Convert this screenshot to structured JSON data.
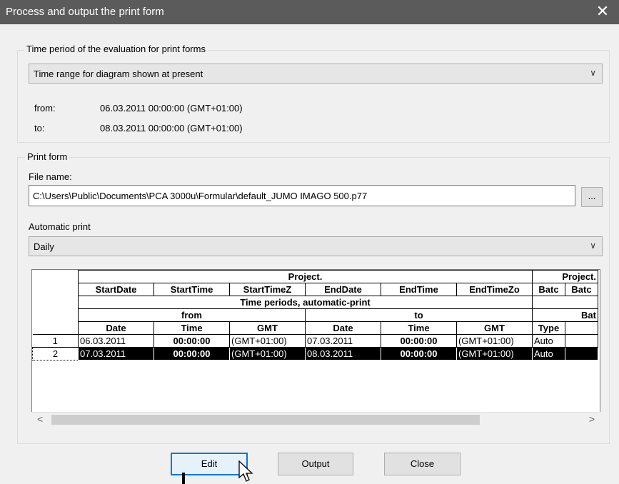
{
  "window": {
    "title": "Process and output the print form",
    "close_glyph": "✕"
  },
  "time_period": {
    "legend": "Time period of the evaluation for print forms",
    "selected": "Time range for diagram shown at present",
    "from_label": "from:",
    "from_value": "06.03.2011 00:00:00 (GMT+01:00)",
    "to_label": "to:",
    "to_value": "08.03.2011 00:00:00 (GMT+01:00)"
  },
  "print_form": {
    "legend": "Print form",
    "file_name_label": "File name:",
    "file_name_value": "C:\\Users\\Public\\Documents\\PCA 3000u\\Formular\\default_JUMO IMAGO 500.p77",
    "browse_label": "...",
    "auto_print_label": "Automatic print",
    "auto_print_selected": "Daily"
  },
  "table": {
    "group_header": "Project.",
    "group_header2": "Project.",
    "columns_row": [
      "StartDate",
      "StartTime",
      "StartTimeZ",
      "EndDate",
      "EndTime",
      "EndTimeZo",
      "Batc",
      "Batc"
    ],
    "section_header": "Time periods, automatic-print",
    "from_header": "from",
    "to_header": "to",
    "bat_header": "Bat",
    "sub_headers": [
      "Date",
      "Time",
      "GMT",
      "Date",
      "Time",
      "GMT",
      "Type"
    ],
    "rows": [
      {
        "num": "1",
        "cells": [
          "06.03.2011",
          "00:00:00",
          "(GMT+01:00)",
          "07.03.2011",
          "00:00:00",
          "(GMT+01:00)",
          "Auto"
        ]
      },
      {
        "num": "2",
        "cells": [
          "07.03.2011",
          "00:00:00",
          "(GMT+01:00)",
          "08.03.2011",
          "00:00:00",
          "(GMT+01:00)",
          "Auto"
        ]
      }
    ],
    "selected_row": 2
  },
  "buttons": {
    "edit": "Edit",
    "output": "Output",
    "close": "Close"
  },
  "icons": {
    "chevron": "chevron-down-icon",
    "scroll_left": "scroll-left-icon",
    "scroll_right": "scroll-right-icon",
    "cursor": "mouse-pointer-icon"
  }
}
